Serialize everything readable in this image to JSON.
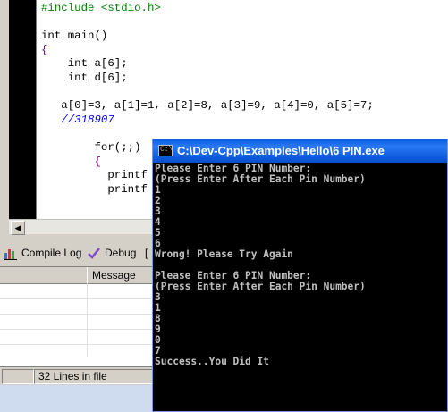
{
  "editor": {
    "code_lines": [
      "#include <stdio.h>",
      "",
      "int main()",
      "{",
      "    int a[6];",
      "    int d[6];",
      "",
      "   a[0]=3, a[1]=1, a[2]=8, a[3]=9, a[4]=0, a[5]=7;",
      "   //318907",
      "",
      "        for(;;)",
      "        {",
      "          printf",
      "          printf"
    ]
  },
  "tabs": {
    "compile_log": "Compile Log",
    "debug": "Debug",
    "partial": "["
  },
  "grid": {
    "message_header": "Message"
  },
  "status": {
    "lines": "32 Lines in file"
  },
  "console": {
    "title": "C:\\Dev-Cpp\\Examples\\Hello\\6 PIN.exe",
    "icon_text": "C:\\",
    "lines": [
      "Please Enter 6 PIN Number:",
      "(Press Enter After Each Pin Number)",
      "1",
      "2",
      "3",
      "4",
      "5",
      "6",
      "Wrong! Please Try Again",
      "",
      "Please Enter 6 PIN Number:",
      "(Press Enter After Each Pin Number)",
      "3",
      "1",
      "8",
      "9",
      "0",
      "7",
      "Success..You Did It"
    ]
  }
}
